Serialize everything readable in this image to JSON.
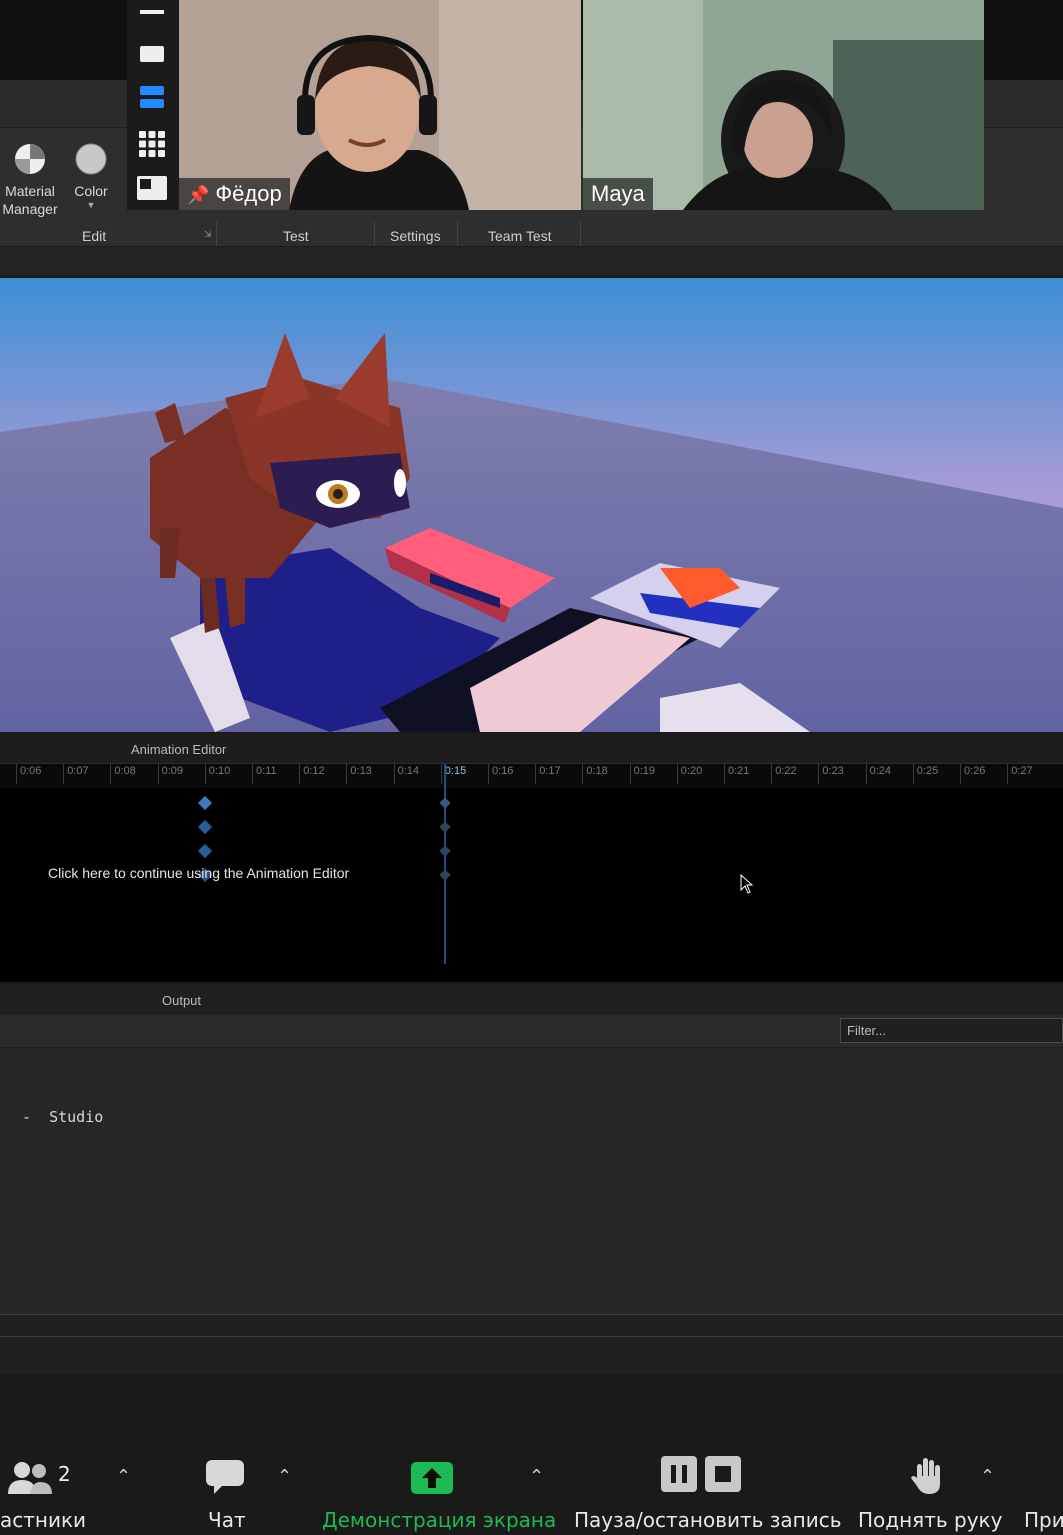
{
  "participants": [
    {
      "name": "Фёдор",
      "pinned": true
    },
    {
      "name": "Maya",
      "pinned": false
    }
  ],
  "ribbon": {
    "tools": [
      {
        "label": "Material Manager",
        "icon": "material-manager-icon"
      },
      {
        "label": "Color",
        "icon": "color-icon"
      }
    ],
    "groups": [
      "Edit",
      "Test",
      "Settings",
      "Team Test"
    ]
  },
  "animation_editor": {
    "title": "Animation Editor",
    "timeline_ticks": [
      "0:06",
      "0:07",
      "0:08",
      "0:09",
      "0:10",
      "0:11",
      "0:12",
      "0:13",
      "0:14",
      "0:15",
      "0:16",
      "0:17",
      "0:18",
      "0:19",
      "0:20",
      "0:21",
      "0:22",
      "0:23",
      "0:24",
      "0:25",
      "0:26",
      "0:27"
    ],
    "current_time": "0:15",
    "message": "Click here to continue using the Animation Editor"
  },
  "output": {
    "title": "Output",
    "filter_placeholder": "Filter...",
    "log_line": "-  Studio"
  },
  "zoom_toolbar": {
    "participants_label": "астники",
    "participants_count": "2",
    "chat_label": "Чат",
    "share_label": "Демонстрация экрана",
    "record_label": "Пауза/остановить запись",
    "raise_hand_label": "Поднять руку",
    "more_label": "При"
  },
  "colors": {
    "accent_blue": "#1f8cff",
    "share_green": "#1db954",
    "keyframe_blue": "#3a7bbf"
  }
}
